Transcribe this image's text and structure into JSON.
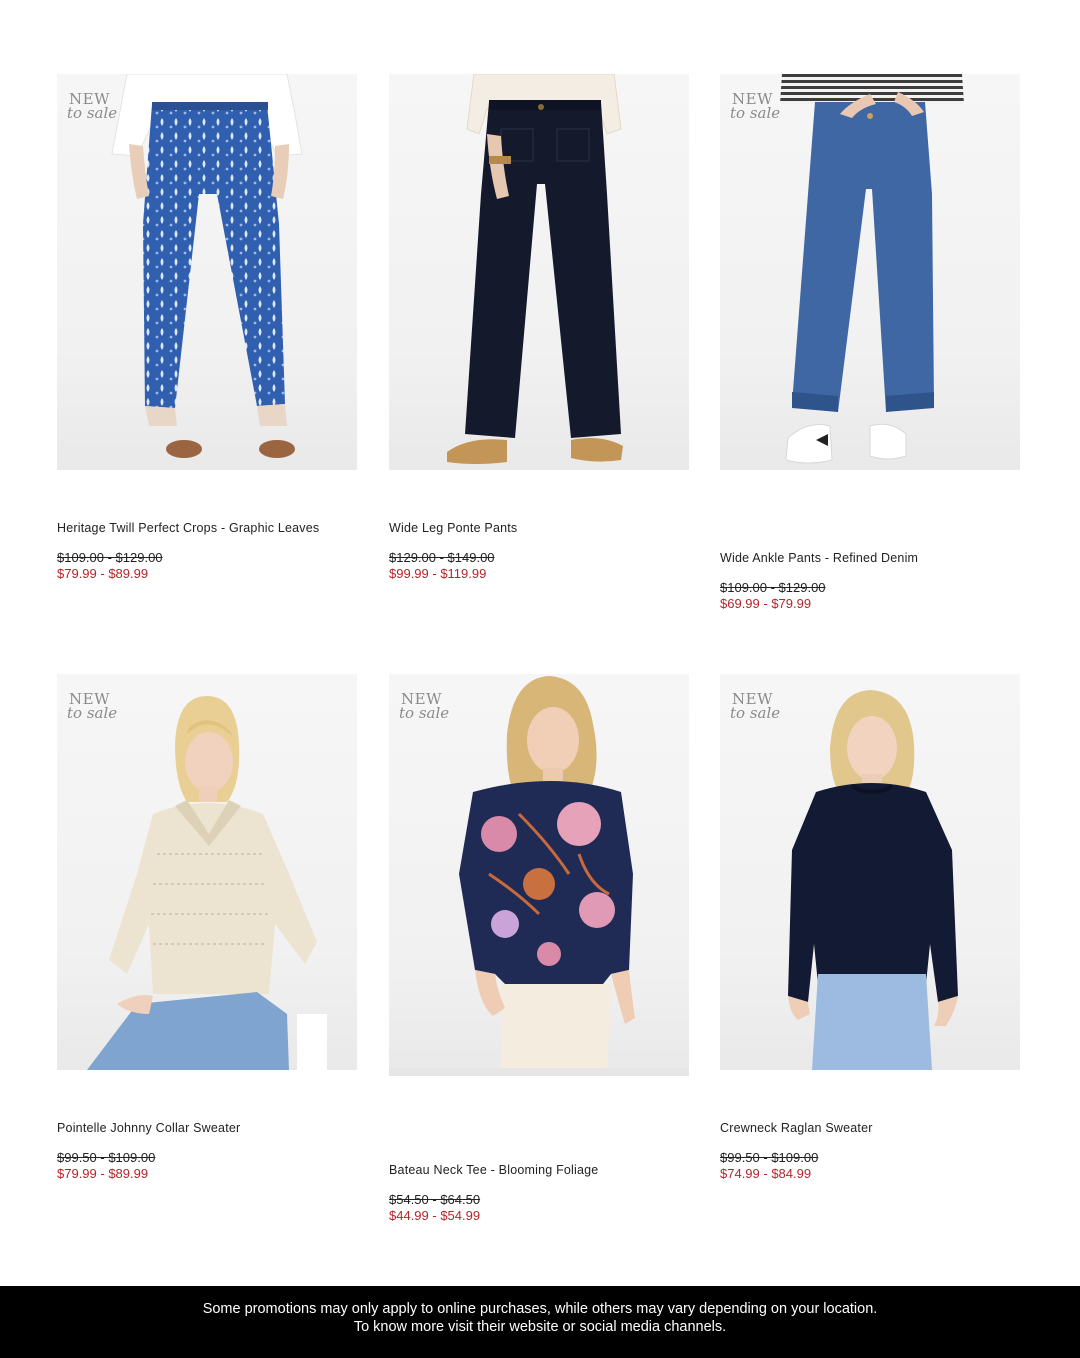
{
  "badge": {
    "line1": "NEW",
    "line2": "to sale"
  },
  "products": [
    {
      "name": "Heritage Twill Perfect Crops - Graphic Leaves",
      "was_price": "$109.00 - $129.00",
      "sale_price": "$79.99 - $89.99",
      "badge": true,
      "image": "blue-print-cropped-pants"
    },
    {
      "name": "Wide Leg Ponte Pants",
      "was_price": "$129.00 - $149.00",
      "sale_price": "$99.99 - $119.99",
      "badge": false,
      "image": "navy-wide-leg-pants"
    },
    {
      "name": "Wide Ankle Pants - Refined Denim",
      "was_price": "$109.00 - $129.00",
      "sale_price": "$69.99 - $79.99",
      "badge": true,
      "image": "denim-wide-ankle-pants"
    },
    {
      "name": "Pointelle Johnny Collar Sweater",
      "was_price": "$99.50 - $109.00",
      "sale_price": "$79.99 - $89.99",
      "badge": true,
      "image": "cream-pointelle-sweater"
    },
    {
      "name": "Bateau Neck Tee - Blooming Foliage",
      "was_price": "$54.50 - $64.50",
      "sale_price": "$44.99 - $54.99",
      "badge": true,
      "image": "floral-navy-tee"
    },
    {
      "name": "Crewneck Raglan Sweater",
      "was_price": "$99.50 - $109.00",
      "sale_price": "$74.99 - $84.99",
      "badge": true,
      "image": "navy-crewneck-sweater"
    }
  ],
  "footer": {
    "line1": "Some promotions may only apply to online purchases, while others may vary depending on your location.",
    "line2": "To know more visit their website or social media channels."
  },
  "colors": {
    "sale_price": "#b3262b",
    "footer_bg": "#000000",
    "badge": "#8b8b8b"
  }
}
